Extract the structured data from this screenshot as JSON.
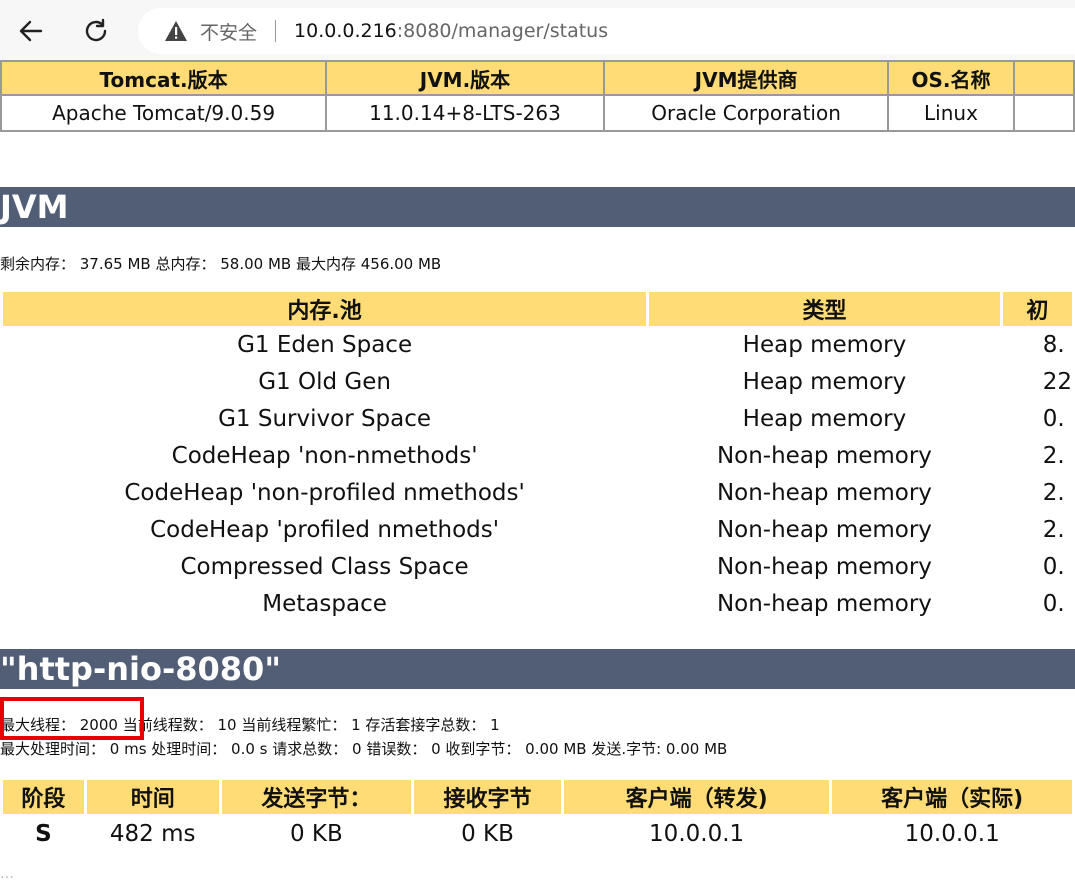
{
  "browser": {
    "insecure_label": "不安全",
    "url_host": "10.0.0.216",
    "url_rest": ":8080/manager/status"
  },
  "server_table": {
    "headers": [
      "Tomcat.版本",
      "JVM.版本",
      "JVM提供商",
      "OS.名称",
      ""
    ],
    "row": [
      "Apache Tomcat/9.0.59",
      "11.0.14+8-LTS-263",
      "Oracle Corporation",
      "Linux",
      ""
    ]
  },
  "jvm": {
    "title": "JVM",
    "memory_line": "剩余内存： 37.65 MB 总内存： 58.00 MB 最大内存 456.00 MB",
    "pool_headers": [
      "内存.池",
      "类型",
      "初"
    ],
    "pools": [
      {
        "name": "G1 Eden Space",
        "type": "Heap memory",
        "initial": "8."
      },
      {
        "name": "G1 Old Gen",
        "type": "Heap memory",
        "initial": "22"
      },
      {
        "name": "G1 Survivor Space",
        "type": "Heap memory",
        "initial": "0."
      },
      {
        "name": "CodeHeap 'non-nmethods'",
        "type": "Non-heap memory",
        "initial": "2."
      },
      {
        "name": "CodeHeap 'non-profiled nmethods'",
        "type": "Non-heap memory",
        "initial": "2."
      },
      {
        "name": "CodeHeap 'profiled nmethods'",
        "type": "Non-heap memory",
        "initial": "2."
      },
      {
        "name": "Compressed Class Space",
        "type": "Non-heap memory",
        "initial": "0."
      },
      {
        "name": "Metaspace",
        "type": "Non-heap memory",
        "initial": "0."
      }
    ]
  },
  "connector": {
    "title": "\"http-nio-8080\"",
    "line1": "最大线程： 2000 当前线程数： 10 当前线程繁忙： 1 存活套接字总数： 1",
    "line2": "最大处理时间： 0 ms 处理时间： 0.0 s 请求总数： 0 错误数： 0 收到字节： 0.00 MB 发送.字节: 0.00 MB",
    "thread_headers": [
      "阶段",
      "时间",
      "发送字节：",
      "接收字节",
      "客户端（转发)",
      "客户端（实际)"
    ],
    "thread_row": [
      "S",
      "482 ms",
      "0 KB",
      "0 KB",
      "10.0.0.1",
      "10.0.0.1"
    ],
    "faded_line": "…"
  },
  "colors": {
    "header_bg": "#ffdc75",
    "section_bg": "#525d76",
    "highlight_border": "#e80000"
  }
}
